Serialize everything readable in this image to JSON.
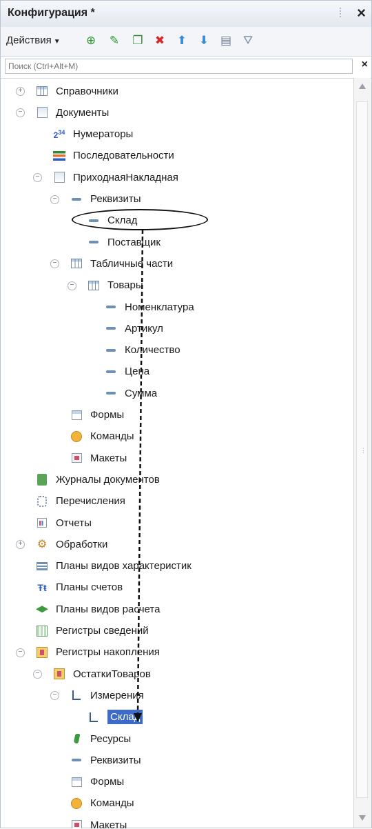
{
  "window": {
    "title": "Конфигурация *"
  },
  "toolbar": {
    "actions_label": "Действия",
    "buttons": [
      {
        "name": "add-icon",
        "glyph": "⊕",
        "color": "#2f9a2f"
      },
      {
        "name": "edit-icon",
        "glyph": "✎",
        "color": "#2f9a2f"
      },
      {
        "name": "copy-icon",
        "glyph": "❐",
        "color": "#3a8a3a"
      },
      {
        "name": "delete-icon",
        "glyph": "✖",
        "color": "#d42a2a"
      },
      {
        "name": "move-up-icon",
        "glyph": "⬆",
        "color": "#3b8ad8"
      },
      {
        "name": "move-down-icon",
        "glyph": "⬇",
        "color": "#3b8ad8"
      },
      {
        "name": "properties-icon",
        "glyph": "▤",
        "color": "#6a7a90"
      },
      {
        "name": "filter-icon",
        "glyph": "⛛",
        "color": "#7a8aa0"
      }
    ]
  },
  "search": {
    "placeholder": "Поиск (Ctrl+Alt+M)"
  },
  "tree": [
    {
      "id": "catalogs",
      "label": "Справочники",
      "icon": "grid",
      "expander": "+"
    },
    {
      "id": "documents",
      "label": "Документы",
      "icon": "doc",
      "expander": "-"
    },
    {
      "id": "numerators",
      "label": "Нумераторы",
      "icon": "numerator"
    },
    {
      "id": "sequences",
      "label": "Последовательности",
      "icon": "sequence"
    },
    {
      "id": "incoming-invoice",
      "label": "ПриходнаяНакладная",
      "icon": "doc",
      "expander": "-"
    },
    {
      "id": "attributes",
      "label": "Реквизиты",
      "icon": "dash",
      "expander": "-"
    },
    {
      "id": "attr-warehouse",
      "label": "Склад",
      "icon": "dash"
    },
    {
      "id": "attr-supplier",
      "label": "Поставщик",
      "icon": "dash"
    },
    {
      "id": "tabular-sections",
      "label": "Табличные части",
      "icon": "grid",
      "expander": "-"
    },
    {
      "id": "goods",
      "label": "Товары",
      "icon": "grid",
      "expander": "-"
    },
    {
      "id": "col-nomenclature",
      "label": "Номенклатура",
      "icon": "dash"
    },
    {
      "id": "col-article",
      "label": "Артикул",
      "icon": "dash"
    },
    {
      "id": "col-quantity",
      "label": "Количество",
      "icon": "dash"
    },
    {
      "id": "col-price",
      "label": "Цена",
      "icon": "dash"
    },
    {
      "id": "col-sum",
      "label": "Сумма",
      "icon": "dash"
    },
    {
      "id": "doc-forms",
      "label": "Формы",
      "icon": "form"
    },
    {
      "id": "doc-commands",
      "label": "Команды",
      "icon": "cmd"
    },
    {
      "id": "doc-layouts",
      "label": "Макеты",
      "icon": "mak"
    },
    {
      "id": "doc-journals",
      "label": "Журналы документов",
      "icon": "journal"
    },
    {
      "id": "enums",
      "label": "Перечисления",
      "icon": "enum"
    },
    {
      "id": "reports",
      "label": "Отчеты",
      "icon": "report"
    },
    {
      "id": "processings",
      "label": "Обработки",
      "icon": "processing",
      "expander": "+"
    },
    {
      "id": "char-types",
      "label": "Планы видов характеристик",
      "icon": "plan"
    },
    {
      "id": "accounts",
      "label": "Планы счетов",
      "icon": "accounts"
    },
    {
      "id": "calc-types",
      "label": "Планы видов расчета",
      "icon": "calc"
    },
    {
      "id": "info-registers",
      "label": "Регистры сведений",
      "icon": "register"
    },
    {
      "id": "accum-registers",
      "label": "Регистры накопления",
      "icon": "accum",
      "expander": "-"
    },
    {
      "id": "goods-balance",
      "label": "ОстаткиТоваров",
      "icon": "accum",
      "expander": "-"
    },
    {
      "id": "dimensions",
      "label": "Измерения",
      "icon": "measure",
      "expander": "-"
    },
    {
      "id": "dim-warehouse",
      "label": "Склад",
      "icon": "measure",
      "selected": true
    },
    {
      "id": "resources",
      "label": "Ресурсы",
      "icon": "resource"
    },
    {
      "id": "reg-attributes",
      "label": "Реквизиты",
      "icon": "dash"
    },
    {
      "id": "reg-forms",
      "label": "Формы",
      "icon": "form"
    },
    {
      "id": "reg-commands",
      "label": "Команды",
      "icon": "cmd"
    },
    {
      "id": "reg-layouts",
      "label": "Макеты",
      "icon": "mak"
    }
  ]
}
